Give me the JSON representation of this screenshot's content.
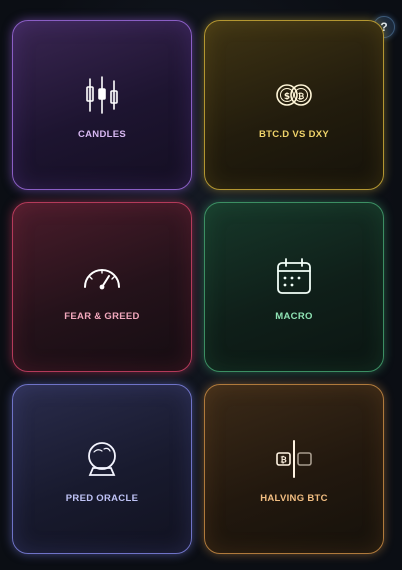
{
  "help": {
    "label": "?",
    "icon": "question-icon"
  },
  "tiles": [
    {
      "label": "CANDLES",
      "icon": "candlestick-icon",
      "color": "#d8b8f2"
    },
    {
      "label": "BTC.D VS DXY",
      "icon": "coins-icon",
      "color": "#efd36a"
    },
    {
      "label": "FEAR & GREED",
      "icon": "gauge-icon",
      "color": "#f2a8bd"
    },
    {
      "label": "MACRO",
      "icon": "calendar-icon",
      "color": "#8fe3b4"
    },
    {
      "label": "PRED ORACLE",
      "icon": "crystal-ball-icon",
      "color": "#bfc3f6"
    },
    {
      "label": "HALVING BTC",
      "icon": "halving-icon",
      "color": "#f2be82"
    }
  ]
}
